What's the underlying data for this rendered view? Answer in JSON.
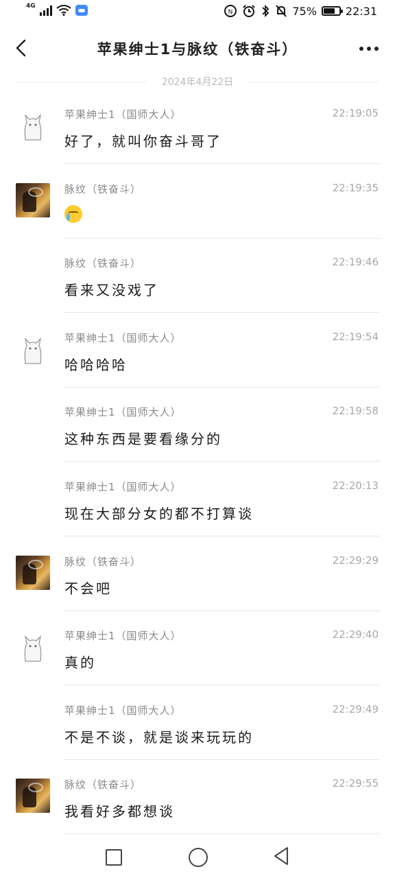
{
  "status_bar": {
    "network": "4G",
    "battery_percent": "75%",
    "battery_level": 0.75,
    "time": "22:31"
  },
  "header": {
    "title": "苹果绅士1与脉纹（铁奋斗）"
  },
  "date_divider": "2024年4月22日",
  "messages": [
    {
      "sender": "苹果绅士1（国师大人）",
      "time": "22:19:05",
      "text": "好了，就叫你奋斗哥了",
      "avatar": "cat"
    },
    {
      "sender": "脉纹（铁奋斗）",
      "time": "22:19:35",
      "text": "",
      "emoji": "crying-face-emoji",
      "avatar": "photo"
    },
    {
      "sender": "脉纹（铁奋斗）",
      "time": "22:19:46",
      "text": "看来又没戏了",
      "avatar": ""
    },
    {
      "sender": "苹果绅士1（国师大人）",
      "time": "22:19:54",
      "text": "哈哈哈哈",
      "avatar": "cat"
    },
    {
      "sender": "苹果绅士1（国师大人）",
      "time": "22:19:58",
      "text": "这种东西是要看缘分的",
      "avatar": ""
    },
    {
      "sender": "苹果绅士1（国师大人）",
      "time": "22:20:13",
      "text": "现在大部分女的都不打算谈",
      "avatar": ""
    },
    {
      "sender": "脉纹（铁奋斗）",
      "time": "22:29:29",
      "text": "不会吧",
      "avatar": "photo"
    },
    {
      "sender": "苹果绅士1（国师大人）",
      "time": "22:29:40",
      "text": "真的",
      "avatar": "cat"
    },
    {
      "sender": "苹果绅士1（国师大人）",
      "time": "22:29:49",
      "text": "不是不谈，就是谈来玩玩的",
      "avatar": ""
    },
    {
      "sender": "脉纹（铁奋斗）",
      "time": "22:29:55",
      "text": "我看好多都想谈",
      "avatar": "photo"
    }
  ],
  "icons": {
    "back": "chevron-left-icon",
    "more": "more-dots-icon",
    "nav_recent": "square-icon",
    "nav_home": "circle-icon",
    "nav_back": "triangle-back-icon"
  }
}
